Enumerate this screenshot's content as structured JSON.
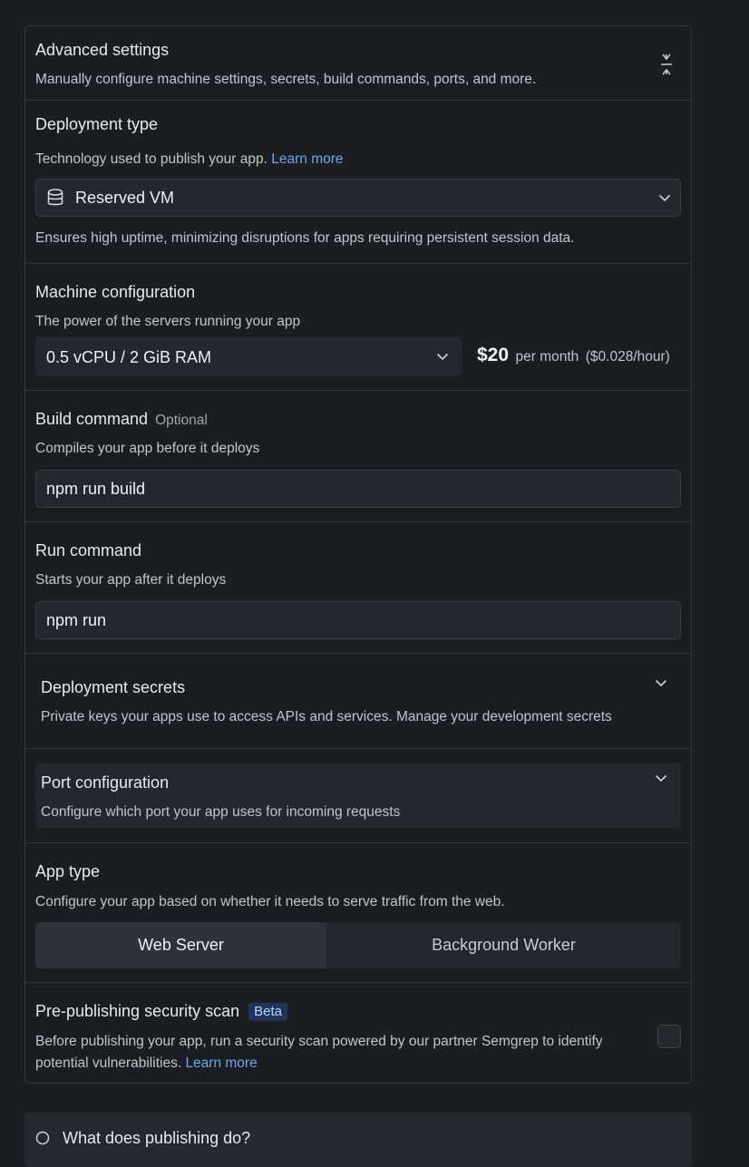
{
  "advanced": {
    "title": "Advanced settings",
    "description": "Manually configure machine settings, secrets, build commands, ports, and more."
  },
  "deployment_type": {
    "title": "Deployment type",
    "description": "Technology used to publish your app.",
    "learn_more": "Learn more",
    "selected": "Reserved VM",
    "note": "Ensures high uptime, minimizing disruptions for apps requiring persistent session data."
  },
  "machine": {
    "title": "Machine configuration",
    "description": "The power of the servers running your app",
    "selected": "0.5 vCPU / 2 GiB RAM",
    "price": "$20",
    "per": "per month",
    "hourly": "($0.028/hour)"
  },
  "build": {
    "title": "Build command",
    "optional": "Optional",
    "description": "Compiles your app before it deploys",
    "value": "npm run build"
  },
  "run": {
    "title": "Run command",
    "description": "Starts your app after it deploys",
    "value": "npm run"
  },
  "secrets": {
    "title": "Deployment secrets",
    "description": "Private keys your apps use to access APIs and services. Manage your development secrets"
  },
  "port": {
    "title": "Port configuration",
    "description": "Configure which port your app uses for incoming requests"
  },
  "app_type": {
    "title": "App type",
    "description": "Configure your app based on whether it needs to serve traffic from the web.",
    "options": [
      "Web Server",
      "Background Worker"
    ],
    "selected": "Web Server"
  },
  "security": {
    "title": "Pre-publishing security scan",
    "badge": "Beta",
    "description_line1": "Before publishing your app, run a security scan powered by our partner Semgrep to identify",
    "description_line2": "potential vulnerabilities.",
    "learn_more": "Learn more",
    "checked": false
  },
  "footer": {
    "title": "What does publishing do?"
  },
  "colors": {
    "background": "#1c1d21",
    "accent_link": "#6aa7f5",
    "beta_badge_bg": "#21355a"
  }
}
